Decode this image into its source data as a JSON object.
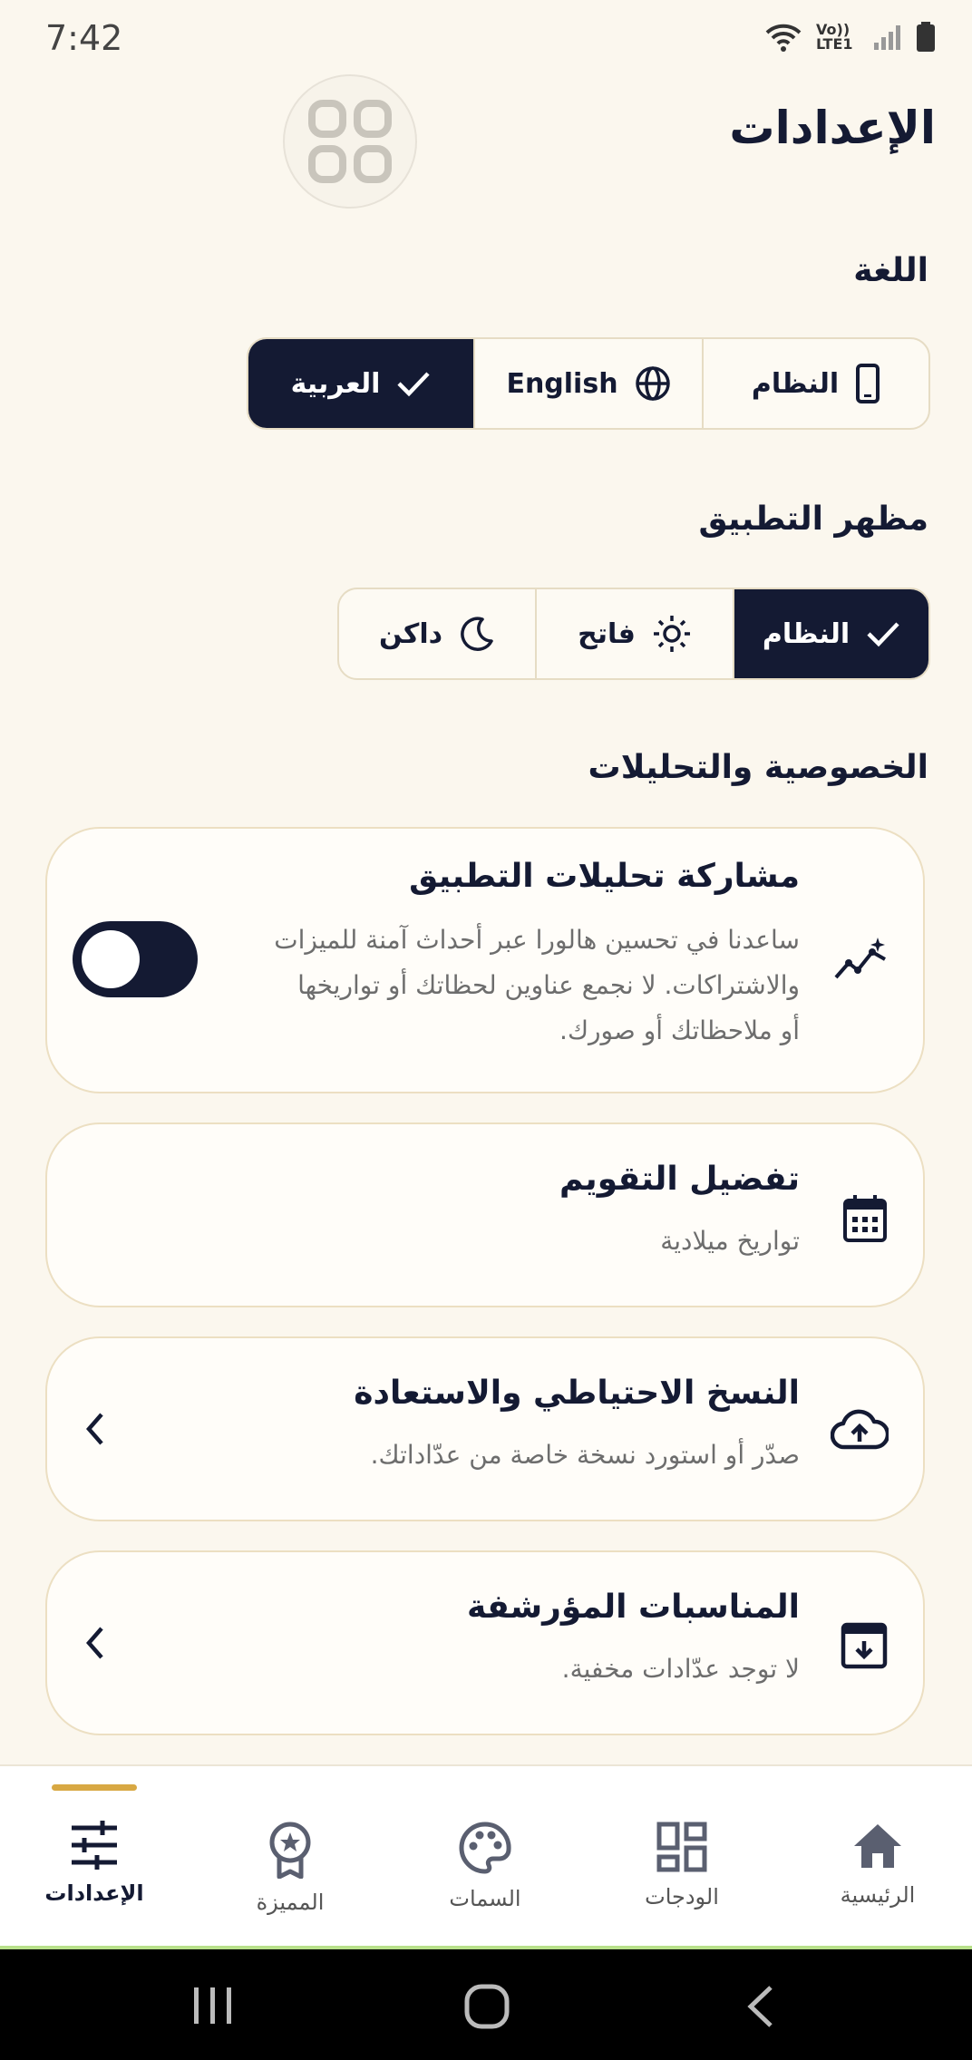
{
  "status_bar": {
    "time": "7:42",
    "network": "Vo)) LTE1"
  },
  "header": {
    "title": "الإعدادات"
  },
  "language": {
    "title": "اللغة",
    "options": [
      {
        "label": "النظام",
        "icon": "phone-icon",
        "selected": false
      },
      {
        "label": "English",
        "icon": "globe-icon",
        "selected": false
      },
      {
        "label": "العربية",
        "icon": "check-icon",
        "selected": true
      }
    ]
  },
  "appearance": {
    "title": "مظهر التطبيق",
    "options": [
      {
        "label": "النظام",
        "icon": "check-icon",
        "selected": true
      },
      {
        "label": "فاتح",
        "icon": "sun-icon",
        "selected": false
      },
      {
        "label": "داكن",
        "icon": "moon-icon",
        "selected": false
      }
    ]
  },
  "privacy": {
    "title": "الخصوصية والتحليلات",
    "analytics": {
      "title": "مشاركة تحليلات التطبيق",
      "lines": [
        "ساعدنا في تحسين هالورا عبر أحداث آمنة للميزات",
        "والاشتراكات. لا نجمع عناوين لحظاتك أو تواريخها",
        "أو ملاحظاتك أو صورك."
      ],
      "enabled": false
    }
  },
  "calendar": {
    "title": "تفضيل التقويم",
    "subtitle": "تواريخ ميلادية"
  },
  "backup": {
    "title": "النسخ الاحتياطي والاستعادة",
    "subtitle": "صدّر أو استورد نسخة خاصة من عدّاداتك."
  },
  "archived": {
    "title": "المناسبات المؤرشفة",
    "subtitle": "لا توجد عدّادات مخفية."
  },
  "nav": {
    "items": [
      {
        "label": "الرئيسية",
        "icon": "home-icon"
      },
      {
        "label": "الودجات",
        "icon": "widgets-icon"
      },
      {
        "label": "السمات",
        "icon": "palette-icon"
      },
      {
        "label": "المميزة",
        "icon": "badge-icon"
      },
      {
        "label": "الإعدادات",
        "icon": "sliders-icon",
        "active": true
      }
    ]
  },
  "colors": {
    "primary": "#141a33",
    "background": "#fbf7ee",
    "accent": "#d8a843"
  }
}
